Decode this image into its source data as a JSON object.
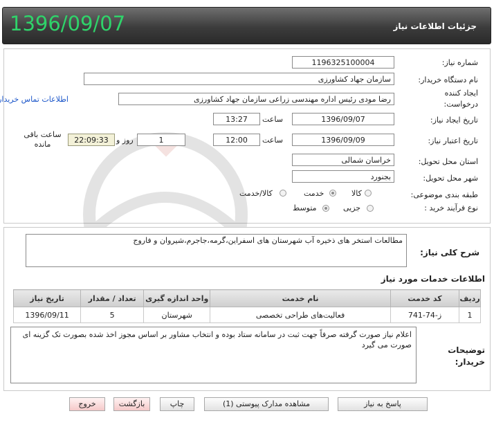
{
  "header": {
    "title": "جزئیات اطلاعات نیاز",
    "date": "1396/09/07"
  },
  "fields": {
    "need_number_label": "شماره نیاز:",
    "need_number": "1196325100004",
    "buyer_org_label": "نام دستگاه خریدار:",
    "buyer_org": "سازمان جهاد کشاورزی",
    "creator_label": "ایجاد کننده درخواست:",
    "creator": "رضا مودی رئیس اداره مهندسی زراعی   سازمان جهاد کشاورزی",
    "contact_link": "اطلاعات تماس خریدار",
    "create_date_label": "تاریخ ایجاد نیاز:",
    "create_date": "1396/09/07",
    "time_label": "ساعت",
    "create_time": "13:27",
    "validity_label": "تاریخ اعتبار نیاز:",
    "validity_date": "1396/09/09",
    "validity_time": "12:00",
    "days_value": "1",
    "days_label": "روز و",
    "remaining_time": "22:09:33",
    "remaining_label": "ساعت باقی مانده",
    "province_label": "استان محل تحویل:",
    "province": "خراسان شمالی",
    "city_label": "شهر محل تحویل:",
    "city": "بجنورد",
    "category_label": "طبقه بندی موضوعی:",
    "category_options": [
      "کالا",
      "خدمت",
      "کالا/خدمت"
    ],
    "purchase_type_label": "نوع فرآیند خرید :",
    "purchase_type_options": [
      "جزیی",
      "متوسط"
    ]
  },
  "description": {
    "label": "شرح کلی نیاز:",
    "text": "مطالعات استخر های ذخیره آب شهرستان های اسفراین،گرمه،جاجرم،شیروان و فاروج"
  },
  "services": {
    "title": "اطلاعات خدمات مورد نیاز",
    "columns": [
      "ردیف",
      "کد خدمت",
      "نام خدمت",
      "واحد اندازه گیری",
      "تعداد / مقدار",
      "تاریخ نیاز"
    ],
    "rows": [
      [
        "1",
        "ز-74-741",
        "فعالیت‌های طراحی تخصصی",
        "شهرستان",
        "5",
        "1396/09/11"
      ]
    ]
  },
  "buyer_notes": {
    "label": "توضیحات خریدار:",
    "text": "اعلام نیاز صورت گرفته صرفاً جهت ثبت در سامانه ستاد بوده و انتخاب مشاور بر اساس مجوز اخذ شده بصورت تک گزینه ای صورت می گیرد"
  },
  "buttons": {
    "reply": "پاسخ به نیاز",
    "attachments": "مشاهده مدارک پیوستی (1)",
    "print": "چاپ",
    "back": "بازگشت",
    "exit": "خروج"
  },
  "colors": {
    "date_green": "#2fd36a",
    "link_blue": "#1a55c9"
  }
}
